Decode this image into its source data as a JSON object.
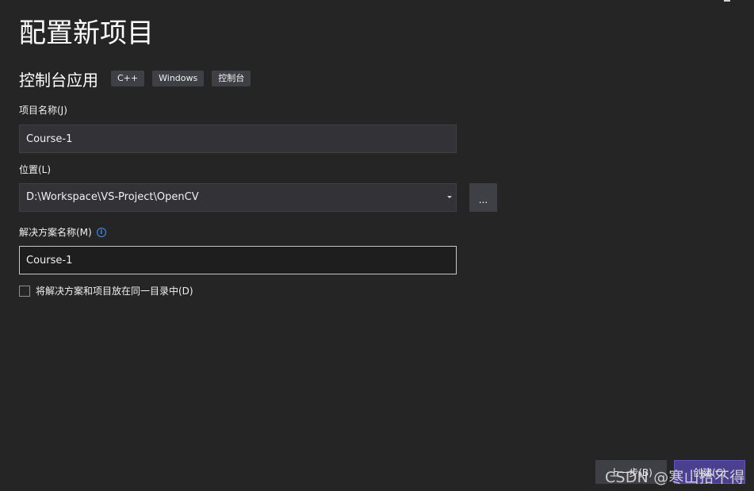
{
  "page": {
    "title": "配置新项目"
  },
  "template": {
    "name": "控制台应用",
    "tags": [
      "C++",
      "Windows",
      "控制台"
    ]
  },
  "project_name": {
    "label": "项目名称(J)",
    "value": "Course-1"
  },
  "location": {
    "label": "位置(L)",
    "value": "D:\\Workspace\\VS-Project\\OpenCV",
    "browse_label": "..."
  },
  "solution_name": {
    "label": "解决方案名称(M)",
    "value": "Course-1",
    "info_icon": "info-icon"
  },
  "same_directory": {
    "label": "将解决方案和项目放在同一目录中(D)",
    "checked": false
  },
  "footer": {
    "back_label": "上一步(B)",
    "create_label": "创建(C)"
  },
  "watermark": {
    "text": "CSDN @寒山拾不得"
  },
  "colors": {
    "background": "#252526",
    "input_background": "#333337",
    "focused_input_background": "#1e1e1e",
    "tag_background": "#3f3f46",
    "primary_button": "#4b3f8f",
    "info_accent": "#3794ff"
  }
}
